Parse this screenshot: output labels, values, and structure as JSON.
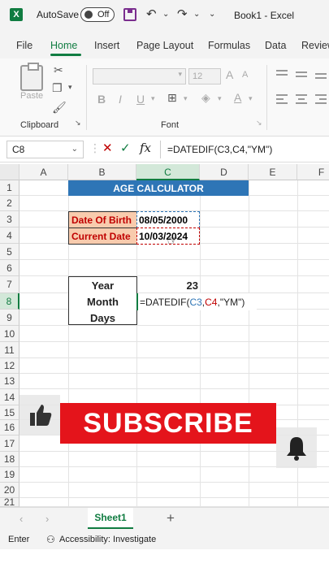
{
  "titlebar": {
    "autosave_label": "AutoSave",
    "toggle_state": "Off",
    "undo_glyph": "↶",
    "redo_glyph": "↷",
    "more_glyph": "⌄",
    "book_title": "Book1 - Excel"
  },
  "tabs": [
    "File",
    "Home",
    "Insert",
    "Page Layout",
    "Formulas",
    "Data",
    "Review"
  ],
  "ribbon": {
    "paste_label": "Paste",
    "clipboard_label": "Clipboard",
    "font_label": "Font",
    "font_size": "12",
    "bold": "B",
    "italic": "I",
    "underline": "U",
    "grow_font": "A",
    "shrink_font": "A",
    "font_color": "A"
  },
  "formula_bar": {
    "name_box": "C8",
    "cancel": "✕",
    "enter": "✓",
    "fx": "fx",
    "formula": "=DATEDIF(C3,C4,\"YM\")"
  },
  "columns": [
    "A",
    "B",
    "C",
    "D",
    "E",
    "F"
  ],
  "rows": [
    "1",
    "2",
    "3",
    "4",
    "5",
    "6",
    "7",
    "8",
    "9",
    "10",
    "11",
    "12",
    "13",
    "14",
    "15",
    "16",
    "17",
    "18",
    "19",
    "20",
    "21"
  ],
  "sheet": {
    "title": "AGE CALCULATOR",
    "dob_label": "Date Of Birth",
    "dob_value": "08/05/2000",
    "current_label": "Current Date",
    "current_value": "10/03/2024",
    "year_label": "Year",
    "year_value": "23",
    "month_label": "Month",
    "days_label": "Days",
    "edit_formula_start": "=DATEDIF(",
    "edit_ref1": "C3",
    "edit_comma1": ",",
    "edit_ref2": "C4",
    "edit_tail": ",\"YM\")"
  },
  "overlay": {
    "subscribe": "SUBSCRIBE"
  },
  "sheet_tabs": {
    "active": "Sheet1",
    "add": "+"
  },
  "status": {
    "mode": "Enter",
    "accessibility": "Accessibility: Investigate"
  }
}
